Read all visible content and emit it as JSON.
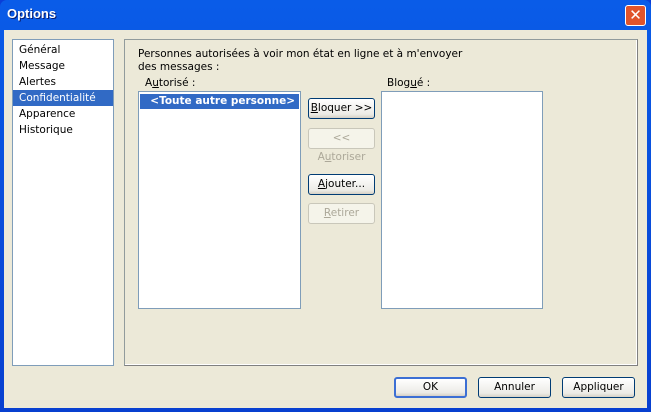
{
  "window": {
    "title": "Options",
    "close_icon": "close-icon"
  },
  "sidebar": {
    "items": [
      {
        "label": "Général"
      },
      {
        "label": "Message"
      },
      {
        "label": "Alertes"
      },
      {
        "label": "Confidentialité",
        "selected": true
      },
      {
        "label": "Apparence"
      },
      {
        "label": "Historique"
      }
    ]
  },
  "privacy": {
    "description": "Personnes autorisées à voir mon état en ligne et à m'envoyer des messages :",
    "allowed_label_pre": "A",
    "allowed_label_u": "u",
    "allowed_label_post": "torisé :",
    "allowed_items": [
      "<Toute autre personne>"
    ],
    "blocked_label_pre": "Blog",
    "blocked_label_u": "u",
    "blocked_label_post": "é :",
    "block_pre": "",
    "block_u": "B",
    "block_post": "loquer >>",
    "allow_pre": "<< A",
    "allow_u": "u",
    "allow_post": "toriser",
    "add_pre": "",
    "add_u": "A",
    "add_post": "jouter...",
    "remove_pre": "",
    "remove_u": "R",
    "remove_post": "etirer"
  },
  "footer": {
    "ok": "OK",
    "cancel": "Annuler",
    "apply": "Appliquer"
  }
}
